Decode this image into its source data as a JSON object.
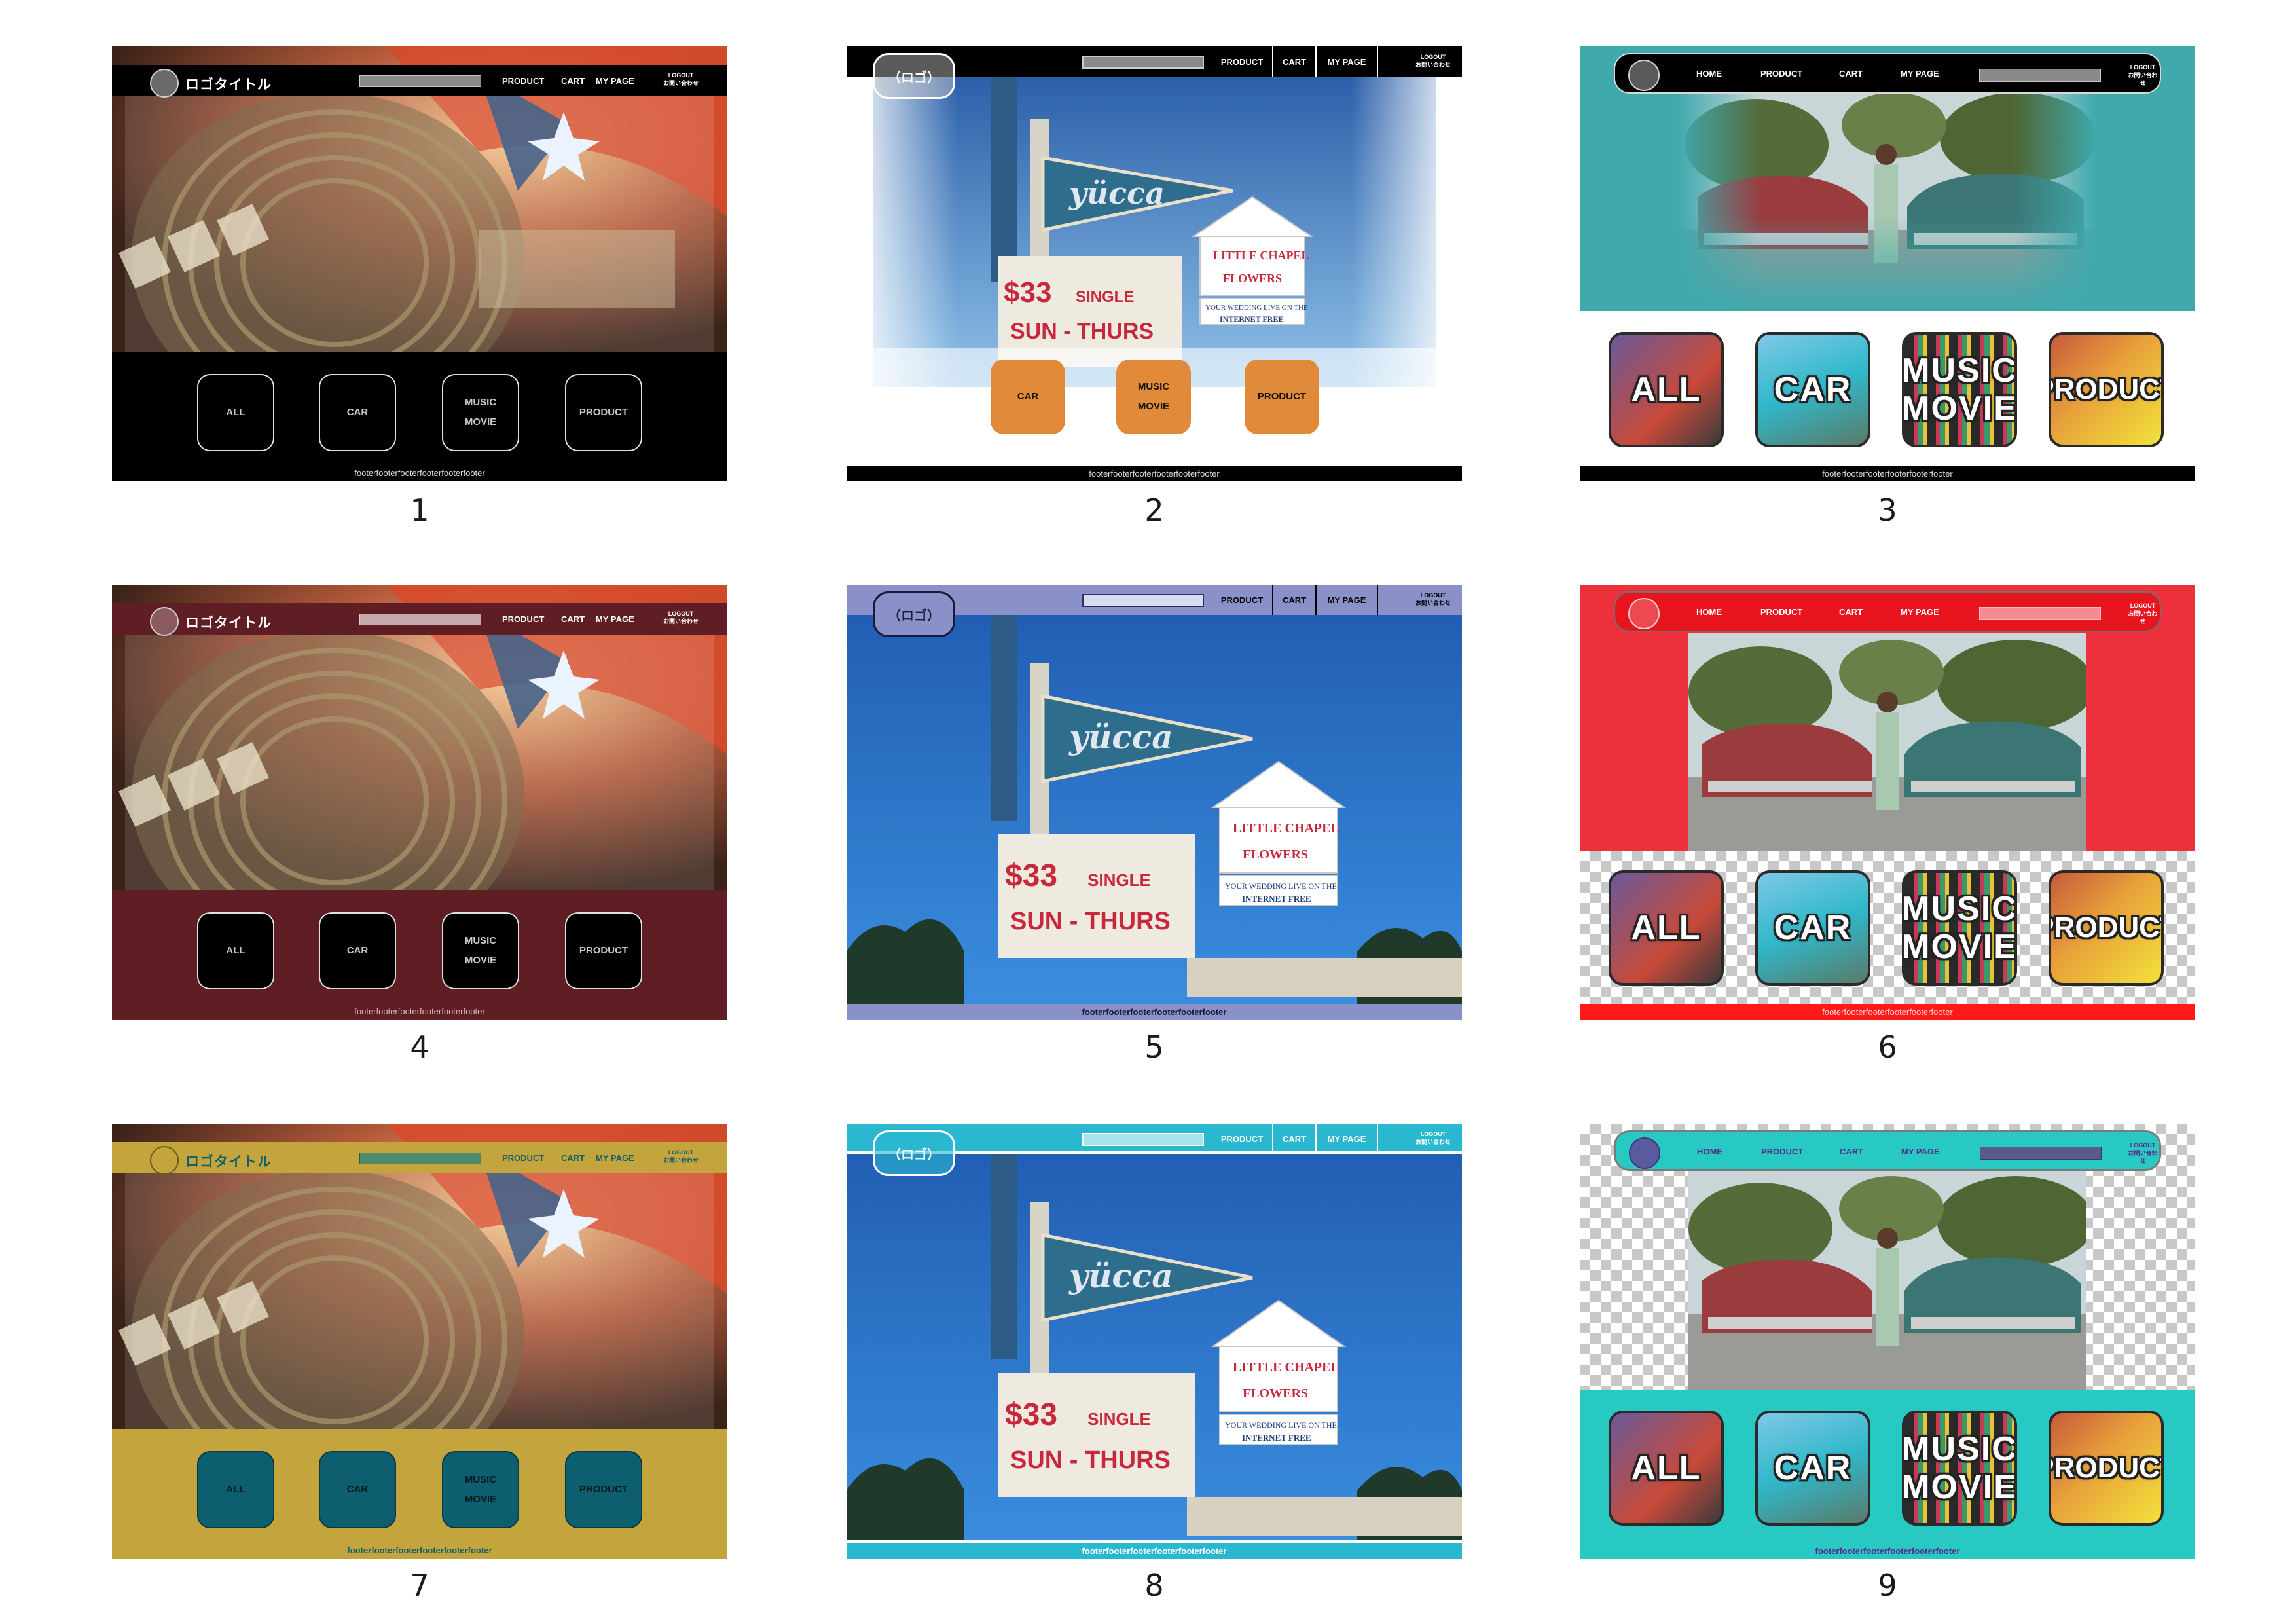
{
  "labels": [
    "1",
    "2",
    "3",
    "4",
    "5",
    "6",
    "7",
    "8",
    "9"
  ],
  "header": {
    "logo_title": "ロゴタイトル",
    "logo_text": "（ロゴ）",
    "nav_home": "HOME",
    "nav_product": "PRODUCT",
    "nav_cart": "CART",
    "nav_mypage": "MY PAGE",
    "logout": "LOGOUT",
    "contact": "お問い合わせ"
  },
  "categories": {
    "all": "ALL",
    "car": "CAR",
    "music": "MUSIC",
    "movie": "MOVIE",
    "product": "PRODUCT"
  },
  "footer": "footerfooterfooterfooterfooterfooter",
  "colors": {
    "variant_1": "#000000",
    "variant_4": "#5e1e24",
    "variant_7": "#c4a43d",
    "variant_2": "#000000",
    "variant_5": "#8a90c8",
    "variant_8": "#29b8cf",
    "variant_3": "#3fa9ad",
    "variant_6": "#ec313d",
    "variant_9": "#29c9c3",
    "button_orange": "#e08a3a",
    "button_teal": "#0d5f6f"
  }
}
